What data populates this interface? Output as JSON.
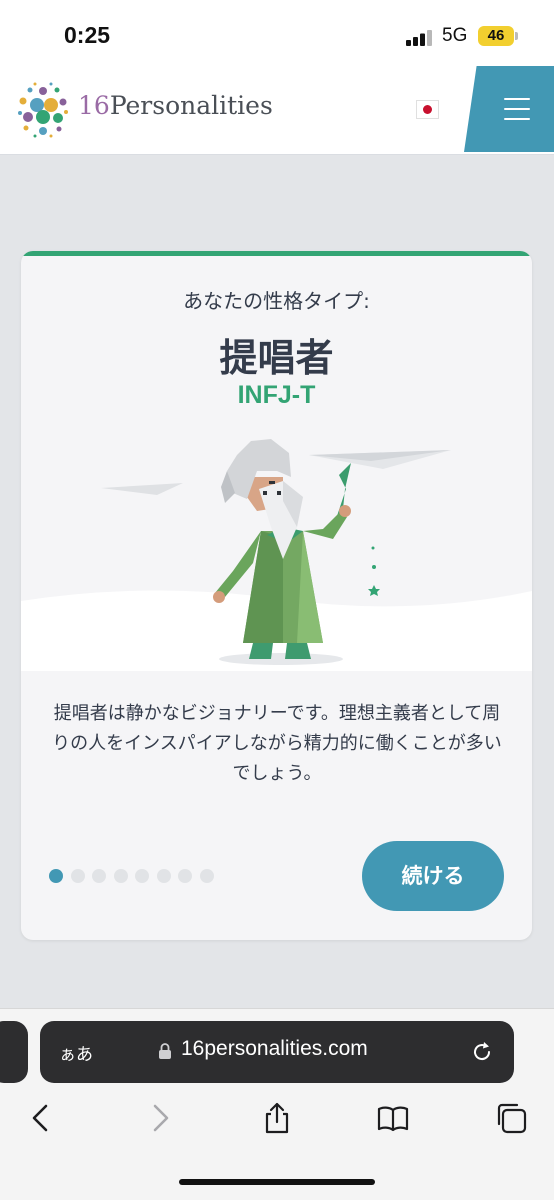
{
  "status_bar": {
    "time": "0:25",
    "network": "5G",
    "battery": "46"
  },
  "header": {
    "logo_number": "16",
    "logo_word": "Personalities",
    "accent_color": "#4298b4"
  },
  "card": {
    "intro": "あなたの性格タイプ:",
    "type_name": "提唱者",
    "type_code": "INFJ-T",
    "description": "提唱者は静かなビジョナリーです。理想主義者として周りの人をインスパイアしながら精力的に働くことが多いでしょう。",
    "pagination": {
      "current": 1,
      "total": 8
    },
    "continue_label": "続ける",
    "accent_green": "#33a474"
  },
  "browser": {
    "text_size_label": "ぁあ",
    "url": "16personalities.com",
    "toolbar": [
      "back-icon",
      "forward-icon",
      "share-icon",
      "bookmarks-icon",
      "tabs-icon"
    ]
  }
}
